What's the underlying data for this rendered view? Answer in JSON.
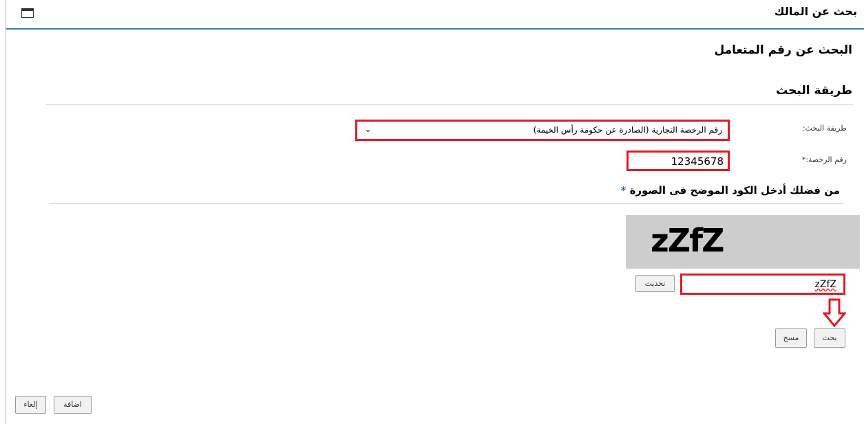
{
  "header": {
    "title": "بحث عن المالك"
  },
  "section": {
    "heading": "البحث عن رقم المتعامل",
    "method_heading": "طريقة البحث"
  },
  "form": {
    "method_label": "طريقة البحث:",
    "method_value": "رقم الرخصة التجارية (الصادرة عن حكومة رأس الخيمة)",
    "license_label": "رقم الرخصة:",
    "license_required": "*",
    "license_value": "12345678"
  },
  "captcha": {
    "prompt": "من فضلك أدخل الكود الموضح فى الصورة",
    "required_marker": "*",
    "image_text": "zZfZ",
    "input_value": "zZfZ",
    "refresh_label": "تحديث"
  },
  "actions": {
    "search_label": "بحث",
    "clear_label": "مسح"
  },
  "footer": {
    "add_label": "اضافة",
    "cancel_label": "إلغاء"
  },
  "colors": {
    "highlight": "#e01b24",
    "header_line": "#2f7fbf"
  },
  "icons": {
    "window": "window-icon",
    "arrow": "arrow-down-icon",
    "dropdown": "chevron-down-icon"
  }
}
